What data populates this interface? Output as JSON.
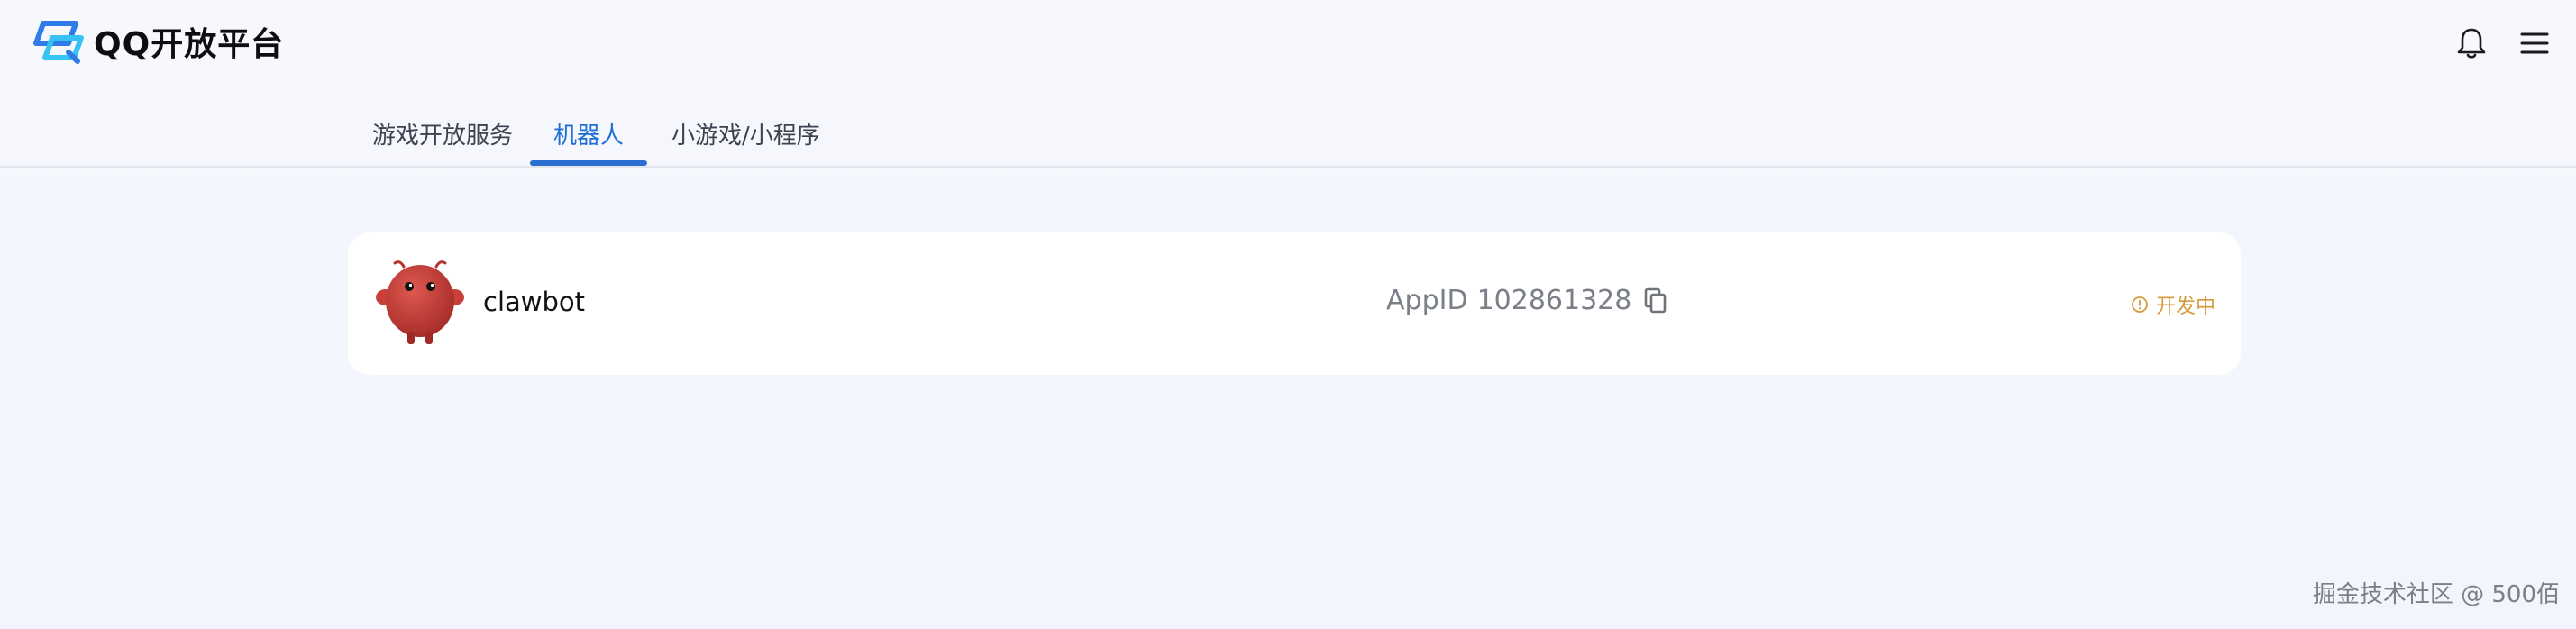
{
  "header": {
    "logo_text": "QQ开放平台",
    "bell_icon": "bell-icon",
    "menu_icon": "hamburger-menu-icon"
  },
  "tabs": [
    {
      "label": "游戏开放服务",
      "active": false
    },
    {
      "label": "机器人",
      "active": true
    },
    {
      "label": "小游戏/小程序",
      "active": false
    }
  ],
  "bot": {
    "name": "clawbot",
    "appid_label": "AppID",
    "appid": "102861328",
    "copy_icon": "copy-icon",
    "status_icon": "info-circle-icon",
    "status": "开发中"
  },
  "watermark": "掘金技术社区 @ 500佰",
  "colors": {
    "accent": "#1f6fd6",
    "status": "#d49a3c",
    "card_bg": "#ffffff",
    "page_bg": "#f3f6fd",
    "avatar": "#c9403a"
  }
}
